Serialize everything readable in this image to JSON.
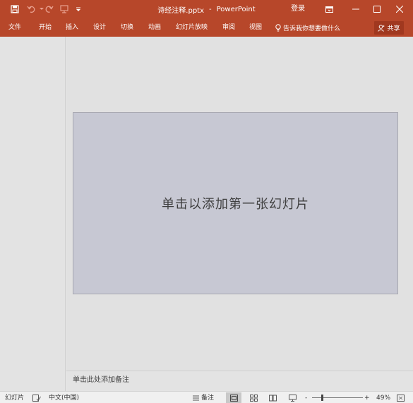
{
  "window": {
    "title": "诗经注释.pptx",
    "app_name": "PowerPoint",
    "title_separator": "-",
    "login_label": "登录",
    "accent_color": "#b7472a"
  },
  "quick_access": [
    {
      "icon": "save-icon"
    },
    {
      "icon": "undo-icon"
    },
    {
      "icon": "redo-icon"
    },
    {
      "icon": "start-slideshow-icon"
    },
    {
      "icon": "customize-quick-access-icon"
    }
  ],
  "ribbon": {
    "tabs": [
      "文件",
      "开始",
      "插入",
      "设计",
      "切换",
      "动画",
      "幻灯片放映",
      "审阅",
      "视图"
    ],
    "tell_me": "告诉我你想要做什么",
    "share_label": "共享"
  },
  "slide": {
    "placeholder": "单击以添加第一张幻灯片"
  },
  "notes": {
    "placeholder": "单击此处添加备注"
  },
  "statusbar": {
    "slide_label": "幻灯片",
    "language": "中文(中国)",
    "notes_label": "备注",
    "zoom_minus": "-",
    "zoom_plus": "+",
    "zoom_level": "49%"
  }
}
